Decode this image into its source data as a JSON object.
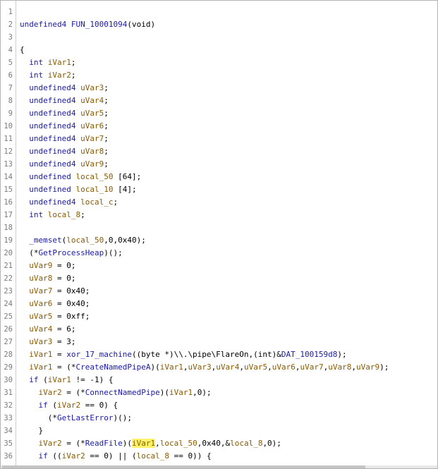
{
  "editor": {
    "lines": [
      {
        "n": "1",
        "tokens": []
      },
      {
        "n": "2",
        "tokens": [
          {
            "t": "undefined4 ",
            "c": "type"
          },
          {
            "t": "FUN_10001094",
            "c": "fn"
          },
          {
            "t": "(void)",
            "c": "sym"
          }
        ]
      },
      {
        "n": "3",
        "tokens": []
      },
      {
        "n": "4",
        "tokens": [
          {
            "t": "{",
            "c": "sym"
          }
        ]
      },
      {
        "n": "5",
        "tokens": [
          {
            "t": "  "
          },
          {
            "t": "int ",
            "c": "type"
          },
          {
            "t": "iVar1",
            "c": "var"
          },
          {
            "t": ";",
            "c": "sym"
          }
        ]
      },
      {
        "n": "6",
        "tokens": [
          {
            "t": "  "
          },
          {
            "t": "int ",
            "c": "type"
          },
          {
            "t": "iVar2",
            "c": "var"
          },
          {
            "t": ";",
            "c": "sym"
          }
        ]
      },
      {
        "n": "7",
        "tokens": [
          {
            "t": "  "
          },
          {
            "t": "undefined4 ",
            "c": "type"
          },
          {
            "t": "uVar3",
            "c": "var"
          },
          {
            "t": ";",
            "c": "sym"
          }
        ]
      },
      {
        "n": "8",
        "tokens": [
          {
            "t": "  "
          },
          {
            "t": "undefined4 ",
            "c": "type"
          },
          {
            "t": "uVar4",
            "c": "var"
          },
          {
            "t": ";",
            "c": "sym"
          }
        ]
      },
      {
        "n": "9",
        "tokens": [
          {
            "t": "  "
          },
          {
            "t": "undefined4 ",
            "c": "type"
          },
          {
            "t": "uVar5",
            "c": "var"
          },
          {
            "t": ";",
            "c": "sym"
          }
        ]
      },
      {
        "n": "10",
        "tokens": [
          {
            "t": "  "
          },
          {
            "t": "undefined4 ",
            "c": "type"
          },
          {
            "t": "uVar6",
            "c": "var"
          },
          {
            "t": ";",
            "c": "sym"
          }
        ]
      },
      {
        "n": "11",
        "tokens": [
          {
            "t": "  "
          },
          {
            "t": "undefined4 ",
            "c": "type"
          },
          {
            "t": "uVar7",
            "c": "var"
          },
          {
            "t": ";",
            "c": "sym"
          }
        ]
      },
      {
        "n": "12",
        "tokens": [
          {
            "t": "  "
          },
          {
            "t": "undefined4 ",
            "c": "type"
          },
          {
            "t": "uVar8",
            "c": "var"
          },
          {
            "t": ";",
            "c": "sym"
          }
        ]
      },
      {
        "n": "13",
        "tokens": [
          {
            "t": "  "
          },
          {
            "t": "undefined4 ",
            "c": "type"
          },
          {
            "t": "uVar9",
            "c": "var"
          },
          {
            "t": ";",
            "c": "sym"
          }
        ]
      },
      {
        "n": "14",
        "tokens": [
          {
            "t": "  "
          },
          {
            "t": "undefined ",
            "c": "type"
          },
          {
            "t": "local_50",
            "c": "var"
          },
          {
            "t": " [64];",
            "c": "sym"
          }
        ]
      },
      {
        "n": "15",
        "tokens": [
          {
            "t": "  "
          },
          {
            "t": "undefined ",
            "c": "type"
          },
          {
            "t": "local_10",
            "c": "var"
          },
          {
            "t": " [4];",
            "c": "sym"
          }
        ]
      },
      {
        "n": "16",
        "tokens": [
          {
            "t": "  "
          },
          {
            "t": "undefined4 ",
            "c": "type"
          },
          {
            "t": "local_c",
            "c": "var"
          },
          {
            "t": ";",
            "c": "sym"
          }
        ]
      },
      {
        "n": "17",
        "tokens": [
          {
            "t": "  "
          },
          {
            "t": "int ",
            "c": "type"
          },
          {
            "t": "local_8",
            "c": "var"
          },
          {
            "t": ";",
            "c": "sym"
          }
        ]
      },
      {
        "n": "18",
        "tokens": []
      },
      {
        "n": "19",
        "tokens": [
          {
            "t": "  "
          },
          {
            "t": "_memset",
            "c": "fn"
          },
          {
            "t": "(",
            "c": "sym"
          },
          {
            "t": "local_50",
            "c": "var"
          },
          {
            "t": ",0,0x40);",
            "c": "sym"
          }
        ]
      },
      {
        "n": "20",
        "tokens": [
          {
            "t": "  (*"
          },
          {
            "t": "GetProcessHeap",
            "c": "fn"
          },
          {
            "t": ")();",
            "c": "sym"
          }
        ]
      },
      {
        "n": "21",
        "tokens": [
          {
            "t": "  "
          },
          {
            "t": "uVar9",
            "c": "var"
          },
          {
            "t": " = 0;",
            "c": "sym"
          }
        ]
      },
      {
        "n": "22",
        "tokens": [
          {
            "t": "  "
          },
          {
            "t": "uVar8",
            "c": "var"
          },
          {
            "t": " = 0;",
            "c": "sym"
          }
        ]
      },
      {
        "n": "23",
        "tokens": [
          {
            "t": "  "
          },
          {
            "t": "uVar7",
            "c": "var"
          },
          {
            "t": " = 0x40;",
            "c": "sym"
          }
        ]
      },
      {
        "n": "24",
        "tokens": [
          {
            "t": "  "
          },
          {
            "t": "uVar6",
            "c": "var"
          },
          {
            "t": " = 0x40;",
            "c": "sym"
          }
        ]
      },
      {
        "n": "25",
        "tokens": [
          {
            "t": "  "
          },
          {
            "t": "uVar5",
            "c": "var"
          },
          {
            "t": " = 0xff;",
            "c": "sym"
          }
        ]
      },
      {
        "n": "26",
        "tokens": [
          {
            "t": "  "
          },
          {
            "t": "uVar4",
            "c": "var"
          },
          {
            "t": " = 6;",
            "c": "sym"
          }
        ]
      },
      {
        "n": "27",
        "tokens": [
          {
            "t": "  "
          },
          {
            "t": "uVar3",
            "c": "var"
          },
          {
            "t": " = 3;",
            "c": "sym"
          }
        ]
      },
      {
        "n": "28",
        "tokens": [
          {
            "t": "  "
          },
          {
            "t": "iVar1",
            "c": "var"
          },
          {
            "t": " = "
          },
          {
            "t": "xor_17_machine",
            "c": "fn"
          },
          {
            "t": "((byte *)\\\\.\\pipe\\FlareOn,(int)&"
          },
          {
            "t": "DAT_100159d8",
            "c": "fn"
          },
          {
            "t": ");",
            "c": "sym"
          }
        ]
      },
      {
        "n": "29",
        "tokens": [
          {
            "t": "  "
          },
          {
            "t": "iVar1",
            "c": "var"
          },
          {
            "t": " = (*"
          },
          {
            "t": "CreateNamedPipeA",
            "c": "fn"
          },
          {
            "t": ")("
          },
          {
            "t": "iVar1",
            "c": "var"
          },
          {
            "t": ","
          },
          {
            "t": "uVar3",
            "c": "var"
          },
          {
            "t": ","
          },
          {
            "t": "uVar4",
            "c": "var"
          },
          {
            "t": ","
          },
          {
            "t": "uVar5",
            "c": "var"
          },
          {
            "t": ","
          },
          {
            "t": "uVar6",
            "c": "var"
          },
          {
            "t": ","
          },
          {
            "t": "uVar7",
            "c": "var"
          },
          {
            "t": ","
          },
          {
            "t": "uVar8",
            "c": "var"
          },
          {
            "t": ","
          },
          {
            "t": "uVar9",
            "c": "var"
          },
          {
            "t": ");",
            "c": "sym"
          }
        ]
      },
      {
        "n": "30",
        "tokens": [
          {
            "t": "  "
          },
          {
            "t": "if",
            "c": "type"
          },
          {
            "t": " ("
          },
          {
            "t": "iVar1",
            "c": "var"
          },
          {
            "t": " != -1) {",
            "c": "sym"
          }
        ]
      },
      {
        "n": "31",
        "tokens": [
          {
            "t": "    "
          },
          {
            "t": "iVar2",
            "c": "var"
          },
          {
            "t": " = (*"
          },
          {
            "t": "ConnectNamedPipe",
            "c": "fn"
          },
          {
            "t": ")("
          },
          {
            "t": "iVar1",
            "c": "var"
          },
          {
            "t": ",0);",
            "c": "sym"
          }
        ]
      },
      {
        "n": "32",
        "tokens": [
          {
            "t": "    "
          },
          {
            "t": "if",
            "c": "type"
          },
          {
            "t": " ("
          },
          {
            "t": "iVar2",
            "c": "var"
          },
          {
            "t": " == 0) {",
            "c": "sym"
          }
        ]
      },
      {
        "n": "33",
        "tokens": [
          {
            "t": "      (*"
          },
          {
            "t": "GetLastError",
            "c": "fn"
          },
          {
            "t": ")();",
            "c": "sym"
          }
        ]
      },
      {
        "n": "34",
        "tokens": [
          {
            "t": "    }",
            "c": "sym"
          }
        ]
      },
      {
        "n": "35",
        "tokens": [
          {
            "t": "    "
          },
          {
            "t": "iVar2",
            "c": "var"
          },
          {
            "t": " = (*"
          },
          {
            "t": "ReadFile",
            "c": "fn"
          },
          {
            "t": ")("
          },
          {
            "t": "iVar1",
            "c": "var",
            "hl": true
          },
          {
            "t": ","
          },
          {
            "t": "local_50",
            "c": "var"
          },
          {
            "t": ",0x40,&"
          },
          {
            "t": "local_8",
            "c": "var"
          },
          {
            "t": ",0);",
            "c": "sym"
          }
        ]
      },
      {
        "n": "36",
        "tokens": [
          {
            "t": "    "
          },
          {
            "t": "if",
            "c": "type"
          },
          {
            "t": " (("
          },
          {
            "t": "iVar2",
            "c": "var"
          },
          {
            "t": " == 0) || ("
          },
          {
            "t": "local_8",
            "c": "var"
          },
          {
            "t": " == 0)) {",
            "c": "sym"
          }
        ]
      }
    ]
  }
}
